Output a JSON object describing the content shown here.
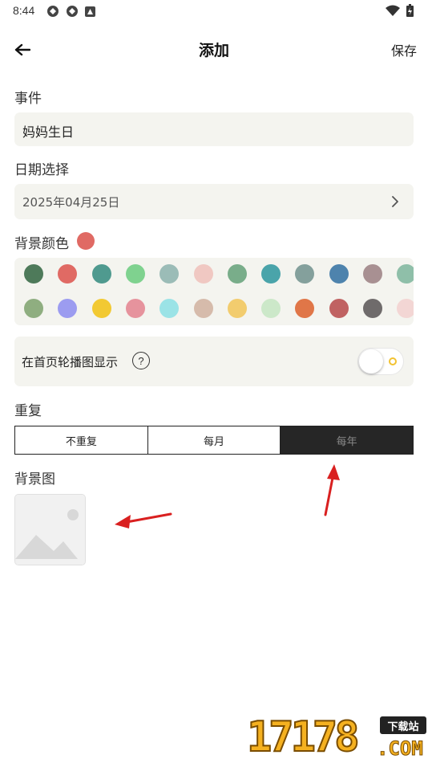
{
  "status_bar": {
    "time": "8:44"
  },
  "header": {
    "title": "添加",
    "save_label": "保存"
  },
  "event": {
    "label": "事件",
    "value": "妈妈生日"
  },
  "date": {
    "label": "日期选择",
    "value": "2025年04月25日"
  },
  "background_color": {
    "label": "背景颜色",
    "selected": "#e06a64",
    "row1": [
      "#4e7a5a",
      "#e06a64",
      "#4f9a8f",
      "#7fd28f",
      "#9bbcb7",
      "#f0c8c2",
      "#79ad8a",
      "#4aa4aa",
      "#84a09c",
      "#4e83ad",
      "#a89092",
      "#8fbfa9"
    ],
    "row2": [
      "#8fae80",
      "#9c9cf0",
      "#f2c932",
      "#e6939d",
      "#9be3e6",
      "#d6bbab",
      "#f2cc6e",
      "#cce8c9",
      "#e07648",
      "#c06262",
      "#6f6b6b",
      "#f3d6d4"
    ]
  },
  "carousel": {
    "label": "在首页轮播图显示",
    "help": "?",
    "enabled": false
  },
  "repeat": {
    "label": "重复",
    "options": [
      "不重复",
      "每月",
      "每年"
    ],
    "selected_index": 2
  },
  "background_image": {
    "label": "背景图"
  },
  "watermark": {
    "digits": "17178",
    "tag": "下载站",
    "domain": ".COM"
  }
}
